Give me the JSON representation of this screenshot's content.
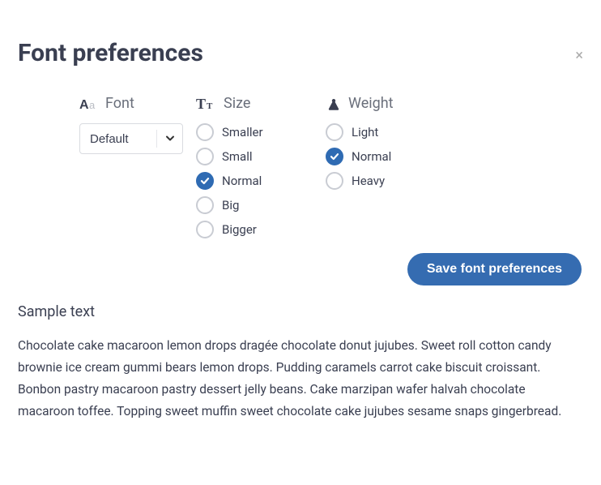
{
  "close_glyph": "×",
  "title": "Font preferences",
  "font": {
    "label": "Font",
    "selected": "Default"
  },
  "size": {
    "label": "Size",
    "options": [
      {
        "label": "Smaller",
        "checked": false
      },
      {
        "label": "Small",
        "checked": false
      },
      {
        "label": "Normal",
        "checked": true
      },
      {
        "label": "Big",
        "checked": false
      },
      {
        "label": "Bigger",
        "checked": false
      }
    ]
  },
  "weight": {
    "label": "Weight",
    "options": [
      {
        "label": "Light",
        "checked": false
      },
      {
        "label": "Normal",
        "checked": true
      },
      {
        "label": "Heavy",
        "checked": false
      }
    ]
  },
  "save_label": "Save font preferences",
  "sample_title": "Sample text",
  "sample_body": "Chocolate cake macaroon lemon drops dragée chocolate donut jujubes. Sweet roll cotton candy brownie ice cream gummi bears lemon drops. Pudding caramels carrot cake biscuit croissant. Bonbon pastry macaroon pastry dessert jelly beans. Cake marzipan wafer halvah chocolate macaroon toffee. Topping sweet muffin sweet chocolate cake jujubes sesame snaps gingerbread."
}
